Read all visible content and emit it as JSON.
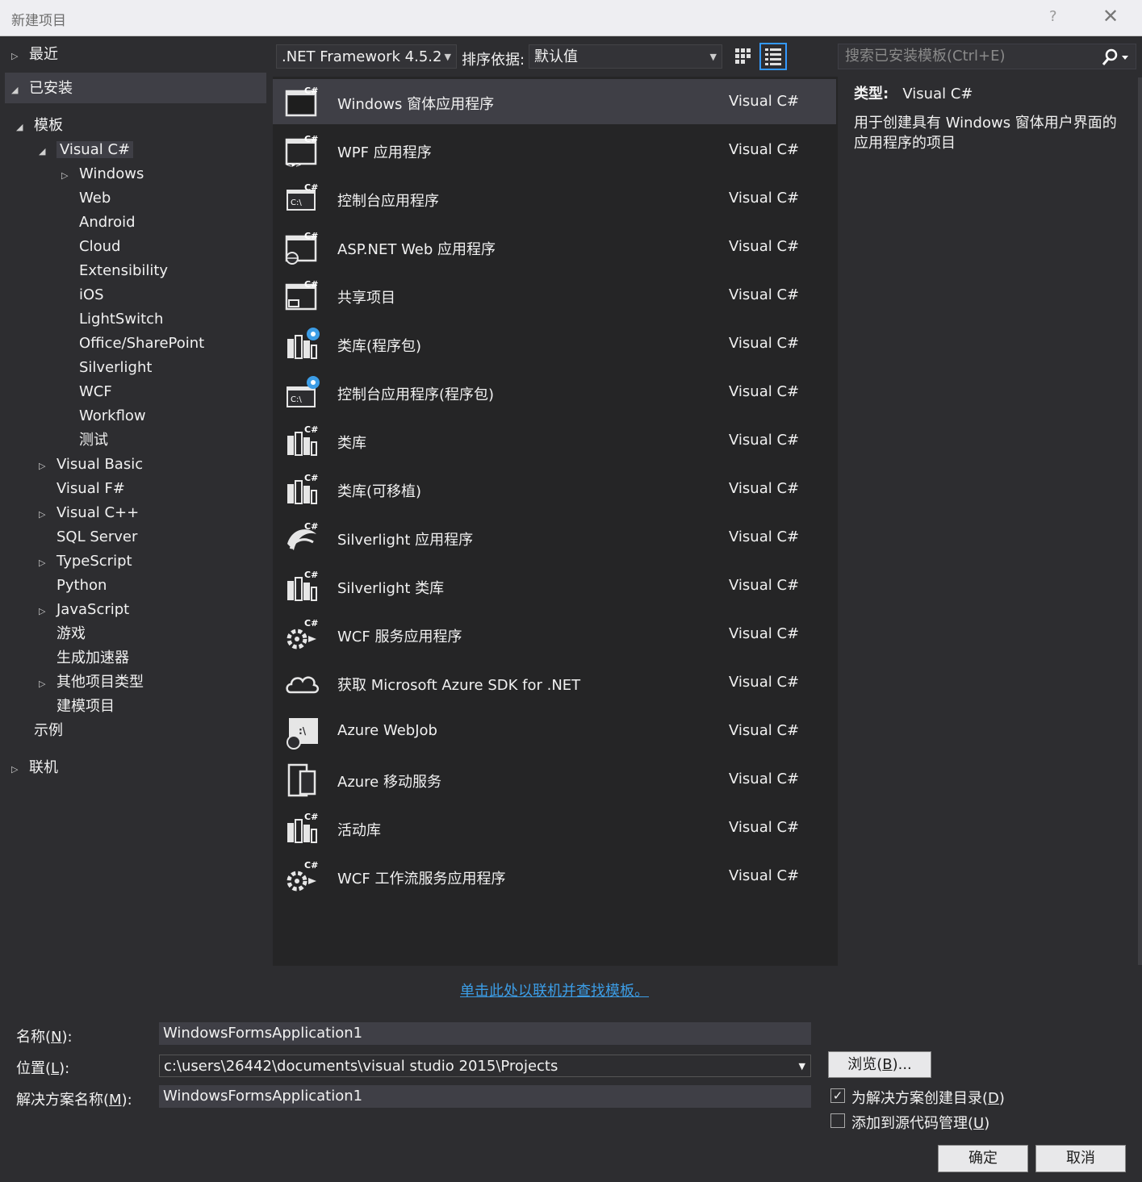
{
  "window": {
    "title": "新建项目",
    "help": "?",
    "close": "✕"
  },
  "tree": {
    "recent": "最近",
    "installed": "已安装",
    "templates": "模板",
    "visual_csharp": "Visual C#",
    "csharp_children": [
      "Windows",
      "Web",
      "Android",
      "Cloud",
      "Extensibility",
      "iOS",
      "LightSwitch",
      "Office/SharePoint",
      "Silverlight",
      "WCF",
      "Workflow",
      "测试"
    ],
    "languages": [
      {
        "label": "Visual Basic",
        "expandable": true
      },
      {
        "label": "Visual F#",
        "expandable": false
      },
      {
        "label": "Visual C++",
        "expandable": true
      },
      {
        "label": "SQL Server",
        "expandable": false
      },
      {
        "label": "TypeScript",
        "expandable": true
      },
      {
        "label": "Python",
        "expandable": false
      },
      {
        "label": "JavaScript",
        "expandable": true
      },
      {
        "label": "游戏",
        "expandable": false
      },
      {
        "label": "生成加速器",
        "expandable": false
      },
      {
        "label": "其他项目类型",
        "expandable": true
      },
      {
        "label": "建模项目",
        "expandable": false
      }
    ],
    "samples": "示例",
    "online": "联机"
  },
  "toolbar": {
    "framework": ".NET Framework 4.5.2",
    "sort_label": "排序依据:",
    "sort_value": "默认值",
    "search_placeholder": "搜索已安装模板(Ctrl+E)"
  },
  "templates": [
    {
      "name": "Windows 窗体应用程序",
      "lang": "Visual C#",
      "icon": "winforms-icon"
    },
    {
      "name": "WPF 应用程序",
      "lang": "Visual C#",
      "icon": "wpf-icon"
    },
    {
      "name": "控制台应用程序",
      "lang": "Visual C#",
      "icon": "console-icon"
    },
    {
      "name": "ASP.NET Web 应用程序",
      "lang": "Visual C#",
      "icon": "aspnet-icon"
    },
    {
      "name": "共享项目",
      "lang": "Visual C#",
      "icon": "shared-project-icon"
    },
    {
      "name": "类库(程序包)",
      "lang": "Visual C#",
      "icon": "class-library-package-icon"
    },
    {
      "name": "控制台应用程序(程序包)",
      "lang": "Visual C#",
      "icon": "console-package-icon"
    },
    {
      "name": "类库",
      "lang": "Visual C#",
      "icon": "class-library-icon"
    },
    {
      "name": "类库(可移植)",
      "lang": "Visual C#",
      "icon": "portable-library-icon"
    },
    {
      "name": "Silverlight 应用程序",
      "lang": "Visual C#",
      "icon": "silverlight-app-icon"
    },
    {
      "name": "Silverlight 类库",
      "lang": "Visual C#",
      "icon": "silverlight-library-icon"
    },
    {
      "name": "WCF 服务应用程序",
      "lang": "Visual C#",
      "icon": "wcf-service-icon"
    },
    {
      "name": "获取 Microsoft Azure SDK for .NET",
      "lang": "Visual C#",
      "icon": "cloud-icon"
    },
    {
      "name": "Azure WebJob",
      "lang": "Visual C#",
      "icon": "webjob-icon"
    },
    {
      "name": "Azure 移动服务",
      "lang": "Visual C#",
      "icon": "mobile-service-icon"
    },
    {
      "name": "活动库",
      "lang": "Visual C#",
      "icon": "activity-library-icon"
    },
    {
      "name": "WCF 工作流服务应用程序",
      "lang": "Visual C#",
      "icon": "wcf-workflow-icon"
    }
  ],
  "details": {
    "type_label": "类型:",
    "type_value": "Visual C#",
    "description": "用于创建具有 Windows 窗体用户界面的应用程序的项目"
  },
  "online_link": "单击此处以联机并查找模板。",
  "form": {
    "name_label_a": "名称(",
    "name_label_key": "N",
    "name_label_b": "):",
    "name_value": "WindowsFormsApplication1",
    "location_label_a": "位置(",
    "location_label_key": "L",
    "location_label_b": "):",
    "location_value": "c:\\users\\26442\\documents\\visual studio 2015\\Projects",
    "solution_label_a": "解决方案名称(",
    "solution_label_key": "M",
    "solution_label_b": "):",
    "solution_value": "WindowsFormsApplication1",
    "browse_a": "浏览(",
    "browse_key": "B",
    "browse_b": ")...",
    "create_dir_a": "为解决方案创建目录(",
    "create_dir_key": "D",
    "create_dir_b": ")",
    "create_dir_checked": true,
    "source_control_a": "添加到源代码管理(",
    "source_control_key": "U",
    "source_control_b": ")",
    "source_control_checked": false,
    "ok": "确定",
    "cancel": "取消"
  },
  "colors": {
    "background": "#2d2d30",
    "list_bg": "#252526",
    "selected": "#3f3f46",
    "link": "#3c9de6",
    "view_active_border": "#3399ff"
  }
}
